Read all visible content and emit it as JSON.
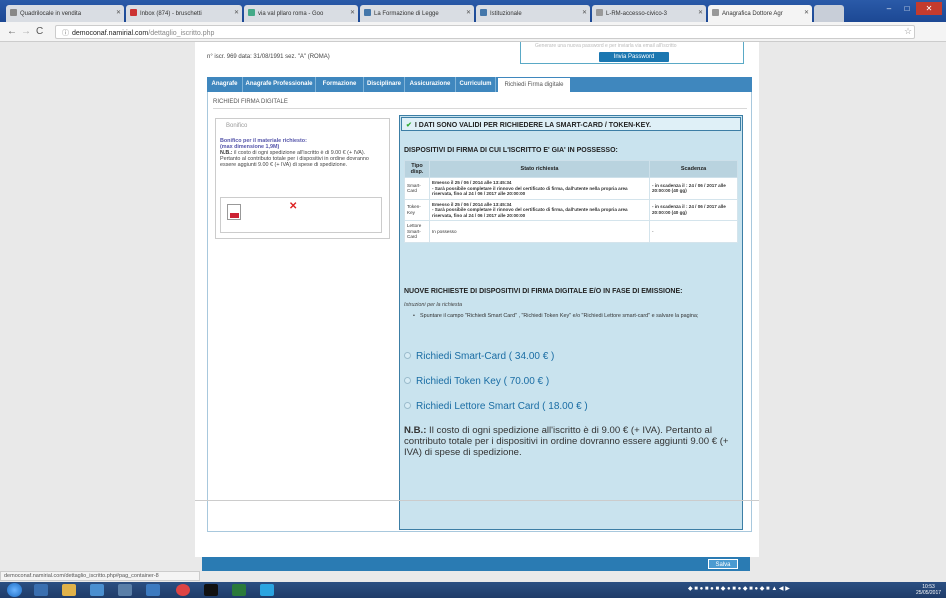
{
  "browser": {
    "tabs": [
      {
        "label": "Quadrilocale in vendita"
      },
      {
        "label": "Inbox (874) - bruschetti"
      },
      {
        "label": "via val pllaro roma - Goo"
      },
      {
        "label": "La Formazione di Legge"
      },
      {
        "label": "Istituzionale"
      },
      {
        "label": "L-RM-accesso-civico-3"
      },
      {
        "label": "Anagrafica Dottore Agr"
      }
    ],
    "url_host": "democonaf.namirial.com",
    "url_path": "/dettaglio_iscritto.php",
    "status_url": "democonaf.namirial.com/dettaglio_iscritto.php#pag_container-8"
  },
  "header": {
    "info": "n° iscr. 969 data: 31/08/1991  sez. \"A\" (ROMA)",
    "faded_text": "Generare una nuova password e per inviarla via email all'iscritto",
    "password_button": "Invia Password"
  },
  "tabs": [
    {
      "label": "Anagrafe"
    },
    {
      "label": "Anagrafe Professionale"
    },
    {
      "label": "Formazione"
    },
    {
      "label": "Disciplinare"
    },
    {
      "label": "Assicurazione"
    },
    {
      "label": "Curriculum"
    },
    {
      "label": "Richiedi Firma digitale"
    }
  ],
  "section_title": "RICHIEDI FIRMA DIGITALE",
  "bonifico": {
    "legend": "Bonifico",
    "title": "Bonifico per il materiale richiesto:",
    "subtitle": "(max dimensione 1,9M)",
    "nb_label": "N.B.:",
    "nb_text": " il costo di ogni spedizione all'iscritto è di 9.00 € (+ IVA).",
    "extra_text": "Pertanto al contributo totale per i dispositivi in ordine dovranno essere aggiunti 9.00 € (+ IVA) di spese di spedizione."
  },
  "valid_message": "I DATI SONO VALIDI PER RICHIEDERE LA SMART-CARD / TOKEN-KEY.",
  "dispositivi": {
    "title": "DISPOSITIVI DI FIRMA DI CUI L'ISCRITTO E' GIA' IN POSSESSO:",
    "columns": [
      "Tipo disp.",
      "Stato richiesta",
      "Scadenza"
    ],
    "rows": [
      {
        "tipo": "Smart-Card",
        "stato": "Emesso il 25 / 06 / 2014 alle 13:45:34",
        "nota": "- Sarà possibile completare il rinnovo del certificato di firma, dall'utente nella propria area riservata, fino al 24 / 06 / 2017 alle 20:00:00",
        "scadenza": "- in scadenza il : 24 / 06 / 2017 alle 20:00:00 (40 gg)"
      },
      {
        "tipo": "Token-Key",
        "stato": "Emesso il 25 / 06 / 2014 alle 13:45:34",
        "nota": "- Sarà possibile completare il rinnovo del certificato di firma, dall'utente nella propria area riservata, fino al 24 / 06 / 2017 alle 20:00:00",
        "scadenza": "- in scadenza il : 24 / 06 / 2017 alle 20:00:00 (40 gg)"
      },
      {
        "tipo": "Lettore Smart-Card",
        "stato": "In possesso",
        "nota": "",
        "scadenza": "-"
      }
    ]
  },
  "nuove": {
    "title": "NUOVE RICHIESTE DI DISPOSITIVI DI FIRMA DIGITALE E/O IN FASE DI EMISSIONE:",
    "istruzioni_label": "Istruzioni per la richiesta",
    "istruzioni_item": "Spuntare il campo \"Richiedi Smart Card\" , \"Richiedi Token Key\" e/o \"Richiedi Lettore smart-card\" e salvare la pagina;",
    "options": [
      {
        "label": "Richiedi Smart-Card ( 34.00 € )"
      },
      {
        "label": "Richiedi Token Key ( 70.00 € )"
      },
      {
        "label": "Richiedi Lettore Smart Card ( 18.00 € )"
      }
    ],
    "nb_label": "N.B.:",
    "nb_text": " Il costo di ogni spedizione all'iscritto è di 9.00 € (+ IVA). Pertanto al contributo totale per i dispositivi in ordine dovranno essere aggiunti 9.00 € (+ IVA) di spese di spedizione."
  },
  "footer": {
    "save_label": "Salva"
  },
  "taskbar": {
    "time": "10:53",
    "date": "25/05/2017"
  }
}
